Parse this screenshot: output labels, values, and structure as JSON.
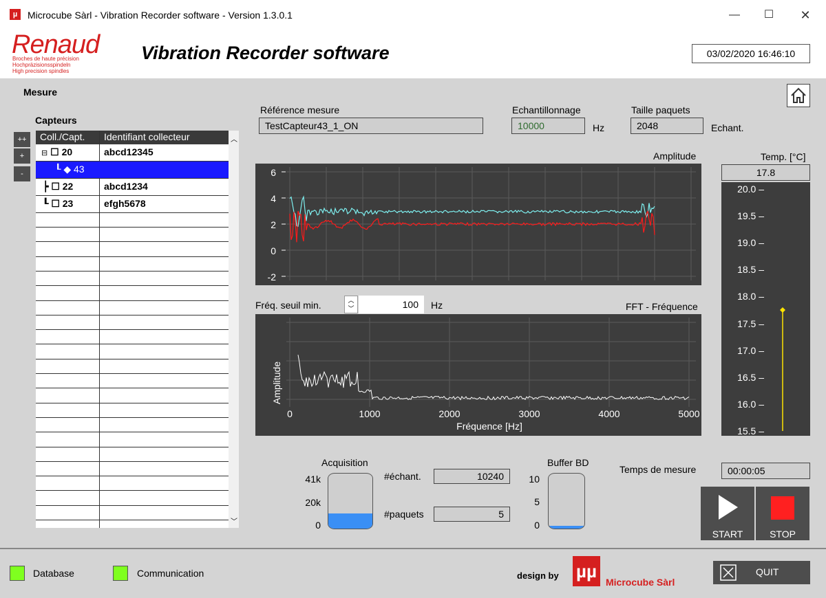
{
  "window": {
    "title": "Microcube Sàrl - Vibration Recorder software - Version  1.3.0.1",
    "icon": "µ",
    "min": "—",
    "max": "☐",
    "close": "✕"
  },
  "header": {
    "logo": "Renaud",
    "logo_lines": [
      "Broches de haute précision",
      "Hochpräzisionsspindeln",
      "High precision spindles"
    ],
    "heading": "Vibration Recorder software",
    "datetime": "03/02/2020 16:46:10"
  },
  "section": {
    "mesure": "Mesure",
    "capteurs": "Capteurs"
  },
  "tree_buttons": [
    "++",
    "+",
    "-"
  ],
  "tree": {
    "col1": "Coll./Capt.",
    "col2": "Identifiant collecteur",
    "rows": [
      {
        "c1": "20",
        "c2": "abcd12345"
      },
      {
        "c1": "43",
        "c2": ""
      },
      {
        "c1": "22",
        "c2": "abcd1234"
      },
      {
        "c1": "23",
        "c2": "efgh5678"
      }
    ]
  },
  "form": {
    "ref_label": "Référence mesure",
    "ref_value": "TestCapteur43_1_ON",
    "ech_label": "Echantillonnage",
    "ech_value": "10000",
    "ech_unit": "Hz",
    "taille_label": "Taille paquets",
    "taille_value": "2048",
    "taille_unit": "Echant."
  },
  "amplitude": {
    "title": "Amplitude",
    "yticks": [
      "6",
      "4",
      "2",
      "0",
      "-2"
    ]
  },
  "fft": {
    "seuil_label": "Fréq. seuil min.",
    "seuil_value": "100",
    "seuil_unit": "Hz",
    "title": "FFT - Fréquence",
    "ylabel": "Amplitude",
    "xlabel": "Fréquence [Hz]",
    "xticks": [
      "0",
      "1000",
      "2000",
      "3000",
      "4000",
      "5000"
    ]
  },
  "temp": {
    "title": "Temp. [°C]",
    "value": "17.8",
    "level": 17.75,
    "min": 15.5,
    "max": 20.0,
    "ticks": [
      "20.0",
      "19.5",
      "19.0",
      "18.5",
      "18.0",
      "17.5",
      "17.0",
      "16.5",
      "16.0",
      "15.5"
    ]
  },
  "acquisition": {
    "title": "Acquisition",
    "ticks": [
      "41k",
      "20k",
      "0"
    ],
    "fill_fraction": 0.27,
    "nech_label": "#échant.",
    "nech_value": "10240",
    "npaq_label": "#paquets",
    "npaq_value": "5"
  },
  "buffer": {
    "title": "Buffer BD",
    "ticks": [
      "10",
      "5",
      "0"
    ],
    "fill_fraction": 0.05
  },
  "temps": {
    "label": "Temps de mesure",
    "value": "00:00:05"
  },
  "controls": {
    "start": "START",
    "stop": "STOP"
  },
  "footer": {
    "database": "Database",
    "communication": "Communication",
    "design_by": "design by",
    "brand": "Microcube Sàrl",
    "quit": "QUIT"
  },
  "colors": {
    "cyan_series": "#7ef0f0",
    "red_series": "#ff1a1a",
    "selection": "#1a1aff",
    "led": "#7fff1f",
    "stop": "#ff2020"
  }
}
